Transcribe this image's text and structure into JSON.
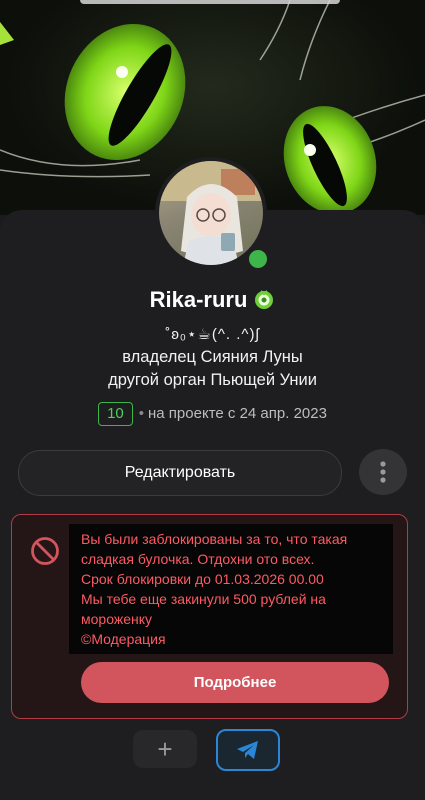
{
  "profile": {
    "username": "Rika-ruru",
    "decor_line": "˚ʚ₀⋆☕︎(^.  .^)ʃ",
    "status_line_1": "владелец Сияния Луны",
    "status_line_2": "другой орган Пьющей Унии",
    "level": "10",
    "joined": "на проекте с 24 апр. 2023",
    "online": true
  },
  "actions": {
    "edit_label": "Редактировать"
  },
  "ban_notice": {
    "lines": [
      "Вы были заблокированы за то, что такая",
      "сладкая булочка. Отдохни ото всех.",
      "Срок блокировки до 01.03.2026 00.00",
      "Мы тебе еще закинули 500 рублей на",
      "мороженку",
      "©Модерация"
    ],
    "details_label": "Подробнее"
  },
  "bottom_actions": {
    "add_label": "+"
  },
  "colors": {
    "accent_green": "#3db54a",
    "ban_red": "#d2545c",
    "telegram_blue": "#2b86d6"
  },
  "icons": {
    "badge": "badge-icon",
    "more": "more-vertical-icon",
    "ban": "ban-icon",
    "telegram": "telegram-icon"
  }
}
